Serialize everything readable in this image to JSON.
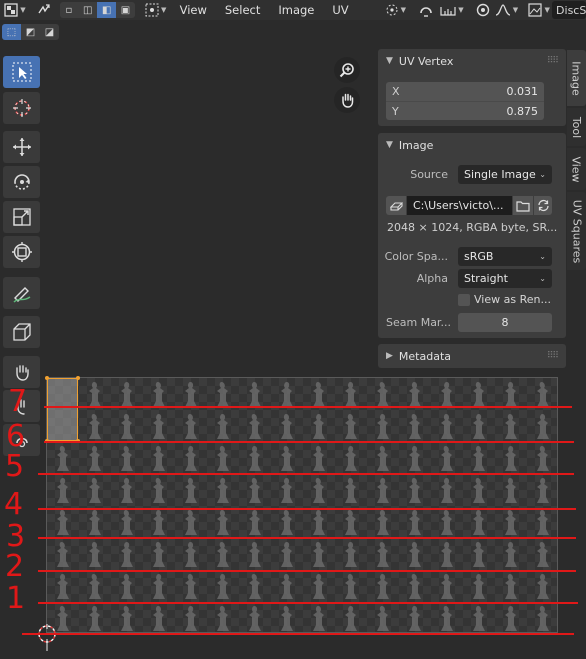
{
  "header": {
    "menus": [
      "View",
      "Select",
      "Image",
      "UV"
    ],
    "workspace_name": "DiscS"
  },
  "uv_vertex_panel": {
    "title": "UV Vertex",
    "x_label": "X",
    "x_value": "0.031",
    "y_label": "Y",
    "y_value": "0.875"
  },
  "image_panel": {
    "title": "Image",
    "source_label": "Source",
    "source_value": "Single Image",
    "path_value": "C:\\Users\\victo\\...",
    "info": "2048 × 1024,  RGBA byte,  SR...",
    "color_space_label": "Color Spa...",
    "color_space_value": "sRGB",
    "alpha_label": "Alpha",
    "alpha_value": "Straight",
    "view_as_render_label": "View as Ren...",
    "seam_margin_label": "Seam Mar...",
    "seam_margin_value": "8"
  },
  "metadata_panel": {
    "title": "Metadata"
  },
  "side_tabs": [
    "Image",
    "Tool",
    "View",
    "UV Squares"
  ],
  "annotations": {
    "row_numbers": [
      "1",
      "2",
      "3",
      "4",
      "5",
      "6",
      "7"
    ],
    "color": "#e01818"
  },
  "colors": {
    "accent": "#4772b3",
    "selection": "#f0a030",
    "panel": "#3d3d3d",
    "background": "#2b2b2b"
  }
}
